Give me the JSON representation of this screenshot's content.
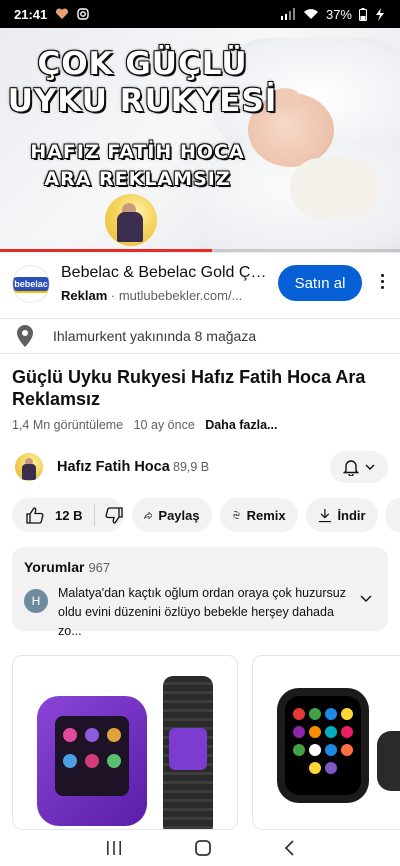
{
  "status_bar": {
    "time": "21:41",
    "battery": "37%"
  },
  "video": {
    "overlay_line1": "ÇOK GÜÇLÜ",
    "overlay_line2": "UYKU RUKYESİ",
    "overlay_line3": "HAFIZ FATİH HOCA",
    "overlay_line4": "ARA REKLAMSIZ",
    "progress": 0.53,
    "progress_color": "#e52d27"
  },
  "ad": {
    "logo_text": "bebelac",
    "title": "Bebelac & Bebelac Gold Çocuk Devam Sütü",
    "label": "Reklam",
    "separator": "·",
    "domain": "mutlubebekler.com/...",
    "cta": "Satın al",
    "cta_color": "#065fd4"
  },
  "store": {
    "text": "Ihlamurkent yakınında 8 mağaza"
  },
  "video_info": {
    "title": "Güçlü Uyku Rukyesi Hafız Fatih Hoca Ara Reklamsız",
    "views": "1,4 Mn görüntüleme",
    "age": "10 ay önce",
    "more": "Daha fazla..."
  },
  "channel": {
    "name": "Hafız Fatih Hoca",
    "subscribers": "89,9 B"
  },
  "actions": {
    "likes": "12 B",
    "share": "Paylaş",
    "remix": "Remix",
    "download": "İndir"
  },
  "comments": {
    "heading": "Yorumlar",
    "count": "967",
    "avatar_letter": "H",
    "top_comment": "Malatya'dan kaçtık oğlum ordan oraya çok huzursuz oldu evini düzenini özlüyo bebekle herşey dahada zo..."
  }
}
